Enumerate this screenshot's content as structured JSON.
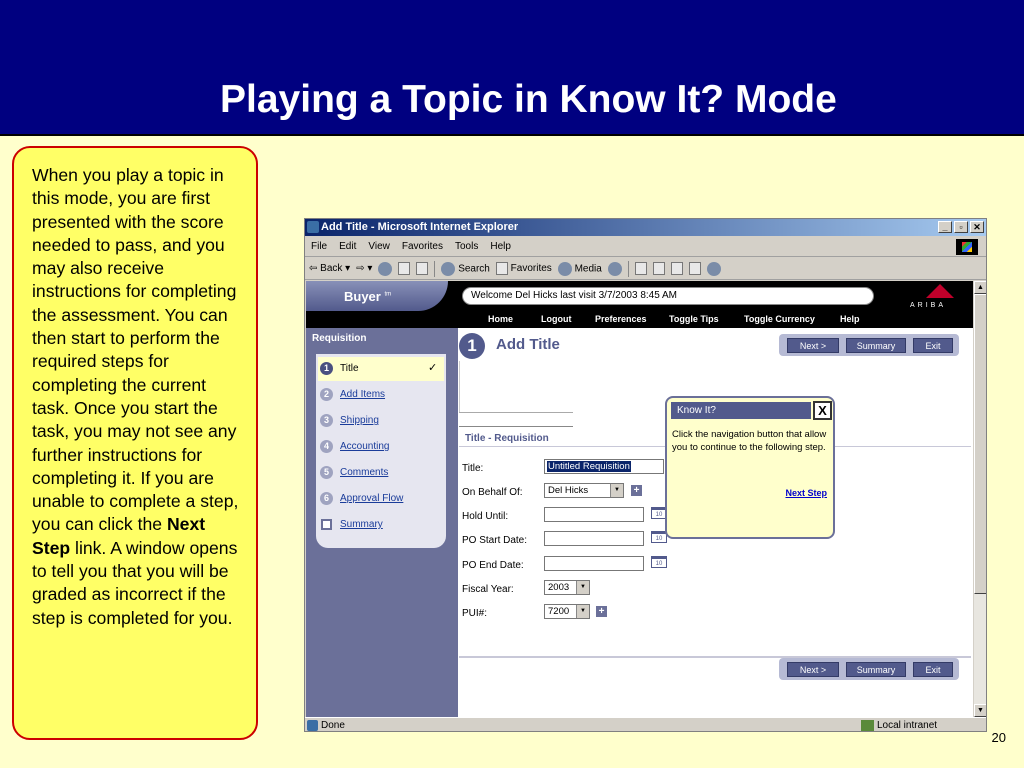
{
  "slide": {
    "title": "Playing a Topic in Know It? Mode",
    "page_number": "20",
    "note": {
      "text_before": "When you play a topic in this mode, you are first presented with the score needed to pass, and you may also receive instructions for completing the assessment. You can then start to perform the required steps for completing the current task. Once you start the task, you may not see any further instructions for completing it. If you are unable to complete a step, you can click the ",
      "bold": "Next Step",
      "text_after": " link. A window opens to tell you that you will be graded as incorrect if the step is completed for you."
    }
  },
  "browser": {
    "title": "Add Title - Microsoft Internet Explorer",
    "menu": [
      "File",
      "Edit",
      "View",
      "Favorites",
      "Tools",
      "Help"
    ],
    "toolbar": {
      "back": "Back",
      "search": "Search",
      "favorites": "Favorites",
      "media": "Media"
    },
    "status": {
      "left": "Done",
      "zone": "Local intranet"
    }
  },
  "app": {
    "brand": "Buyer",
    "brand_tm": "tm",
    "welcome": "Welcome Del Hicks  last visit 3/7/2003 8:45 AM",
    "logo_text": "ARIBA",
    "nav": [
      "Home",
      "Logout",
      "Preferences",
      "Toggle Tips",
      "Toggle Currency",
      "Help"
    ],
    "sidebar": {
      "title": "Requisition",
      "steps": [
        {
          "num": "1",
          "label": "Title",
          "check": "✓"
        },
        {
          "num": "2",
          "label": "Add Items"
        },
        {
          "num": "3",
          "label": "Shipping"
        },
        {
          "num": "4",
          "label": "Accounting"
        },
        {
          "num": "5",
          "label": "Comments"
        },
        {
          "num": "6",
          "label": "Approval Flow"
        },
        {
          "num": "",
          "label": "Summary"
        }
      ]
    },
    "page": {
      "step_number": "1",
      "heading": "Add Title",
      "section": "Title - Requisition",
      "buttons": {
        "next": "Next >",
        "summary": "Summary",
        "exit": "Exit"
      },
      "fields": {
        "title": {
          "label": "Title:",
          "value": "Untitled Requisition"
        },
        "on_behalf": {
          "label": "On Behalf Of:",
          "value": "Del Hicks"
        },
        "hold_until": {
          "label": "Hold Until:"
        },
        "po_start": {
          "label": "PO Start Date:"
        },
        "po_end": {
          "label": "PO End Date:"
        },
        "fiscal_year": {
          "label": "Fiscal Year:",
          "value": "2003"
        },
        "pui": {
          "label": "PUI#:",
          "value": "7200"
        }
      },
      "calendar_label": "10"
    },
    "popup": {
      "title": "Know It?",
      "close": "X",
      "body": "Click the navigation button that allow you to continue to the following step.",
      "link": "Next Step"
    }
  }
}
